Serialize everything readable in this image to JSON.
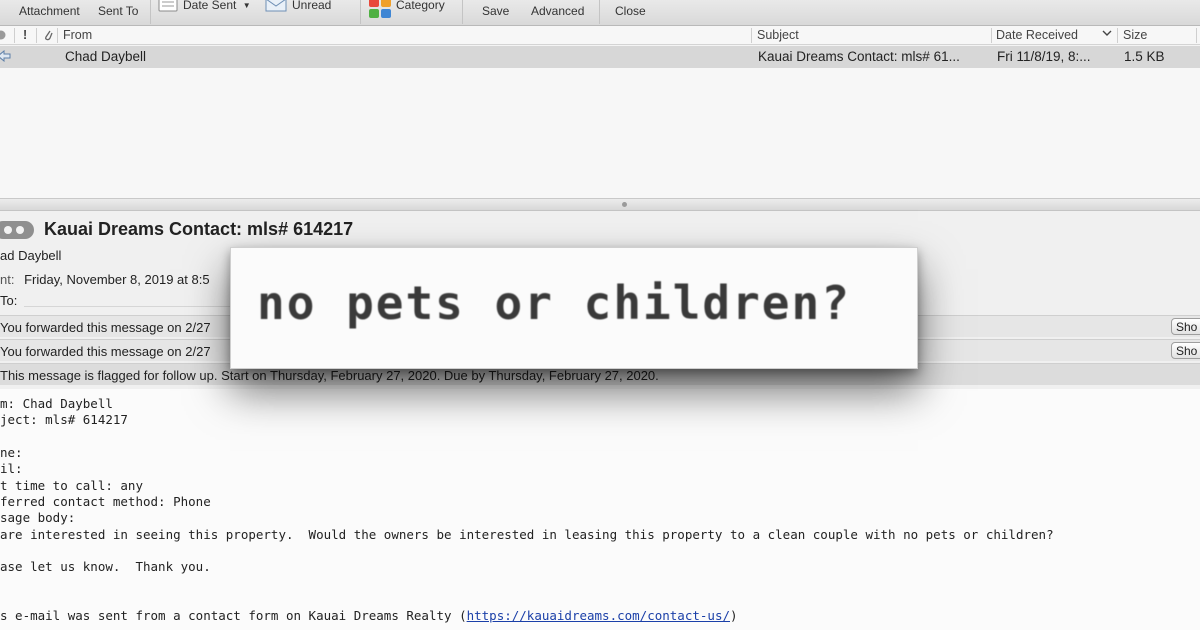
{
  "toolbar": {
    "attachment_label": "Attachment",
    "sent_to_label": "Sent To",
    "date_sent_label": "Date Sent",
    "unread_label": "Unread",
    "category_label": "Category",
    "save_label": "Save",
    "advanced_label": "Advanced",
    "close_label": "Close"
  },
  "list": {
    "headers": {
      "from": "From",
      "subject": "Subject",
      "date_received": "Date Received",
      "size": "Size"
    },
    "row": {
      "from": "Chad Daybell",
      "subject": "Kauai Dreams Contact: mls# 61...",
      "date_received": "Fri 11/8/19, 8:...",
      "size": "1.5 KB"
    }
  },
  "message": {
    "subject": "Kauai Dreams Contact: mls# 614217",
    "from": "ad Daybell",
    "sent_key": "nt:",
    "sent_value": "Friday, November 8, 2019 at 8:5",
    "to_key": "To:",
    "banners": [
      {
        "text": "You forwarded this message on 2/27",
        "button": "Sho"
      },
      {
        "text": "You forwarded this message on 2/27",
        "button": "Sho"
      }
    ],
    "flag_banner": "This message is flagged for follow up. Start on Thursday, February 27, 2020.  Due by Thursday, February 27, 2020."
  },
  "body": {
    "lines": [
      "m: Chad Daybell",
      "ject: mls# 614217",
      "ne:",
      "il:",
      "t time to call: any",
      "ferred contact method: Phone",
      "sage body:",
      "are interested in seeing this property.  Would the owners be interested in leasing this property to a clean couple with no pets or children?",
      "ase let us know.  Thank you."
    ],
    "footer_prefix": "s e-mail was sent from a contact form on Kauai Dreams Realty (",
    "footer_link": "https://kauaidreams.com/contact-us/",
    "footer_suffix": ")"
  },
  "zoom": {
    "text": "no pets or children?"
  },
  "colors": {
    "toolbar_bg": "#dedede",
    "selected_row": "#d7d7d7",
    "link": "#1a3fa8"
  },
  "icons": [
    "attachment-icon",
    "sent-to-icon",
    "date-sent-icon",
    "unread-envelope-icon",
    "category-icon",
    "read-status-icon",
    "flag-icon",
    "paperclip-icon",
    "forwarded-arrow-icon",
    "message-pill-icon"
  ]
}
